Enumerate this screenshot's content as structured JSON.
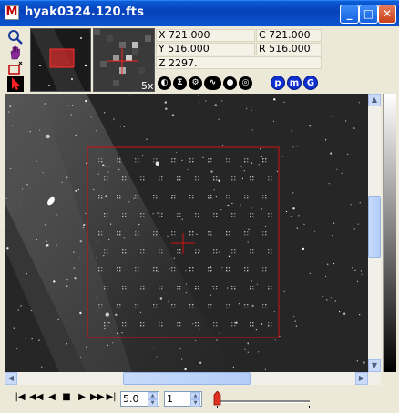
{
  "window": {
    "title": "hyak0324.120.fts",
    "app_icon_letter": "M",
    "buttons": {
      "minimize": "_",
      "maximize": "□",
      "close": "✕"
    }
  },
  "toolbar": {
    "tools": [
      "magnify-icon",
      "hand-icon",
      "region-icon",
      "pointer-icon"
    ]
  },
  "magnifier": {
    "zoom_label": "5x"
  },
  "coords": {
    "x": "X 721.000",
    "c": "C 721.000",
    "y": "Y 516.000",
    "r": "R 516.000",
    "z": "Z 2297."
  },
  "tool_buttons": [
    "◐",
    "Σ",
    "⚙",
    "∿",
    "●",
    "◎"
  ],
  "blue_buttons": [
    "p",
    "m",
    "G"
  ],
  "playback": {
    "controls": [
      "|◀",
      "◀◀",
      "◀",
      "■",
      "▶",
      "▶▶",
      "▶|"
    ],
    "speed_value": "5.0",
    "frame_value": "1"
  },
  "colors": {
    "title_bar": "#0740b8",
    "region_box": "#d01010",
    "background": "#ece9d8"
  }
}
